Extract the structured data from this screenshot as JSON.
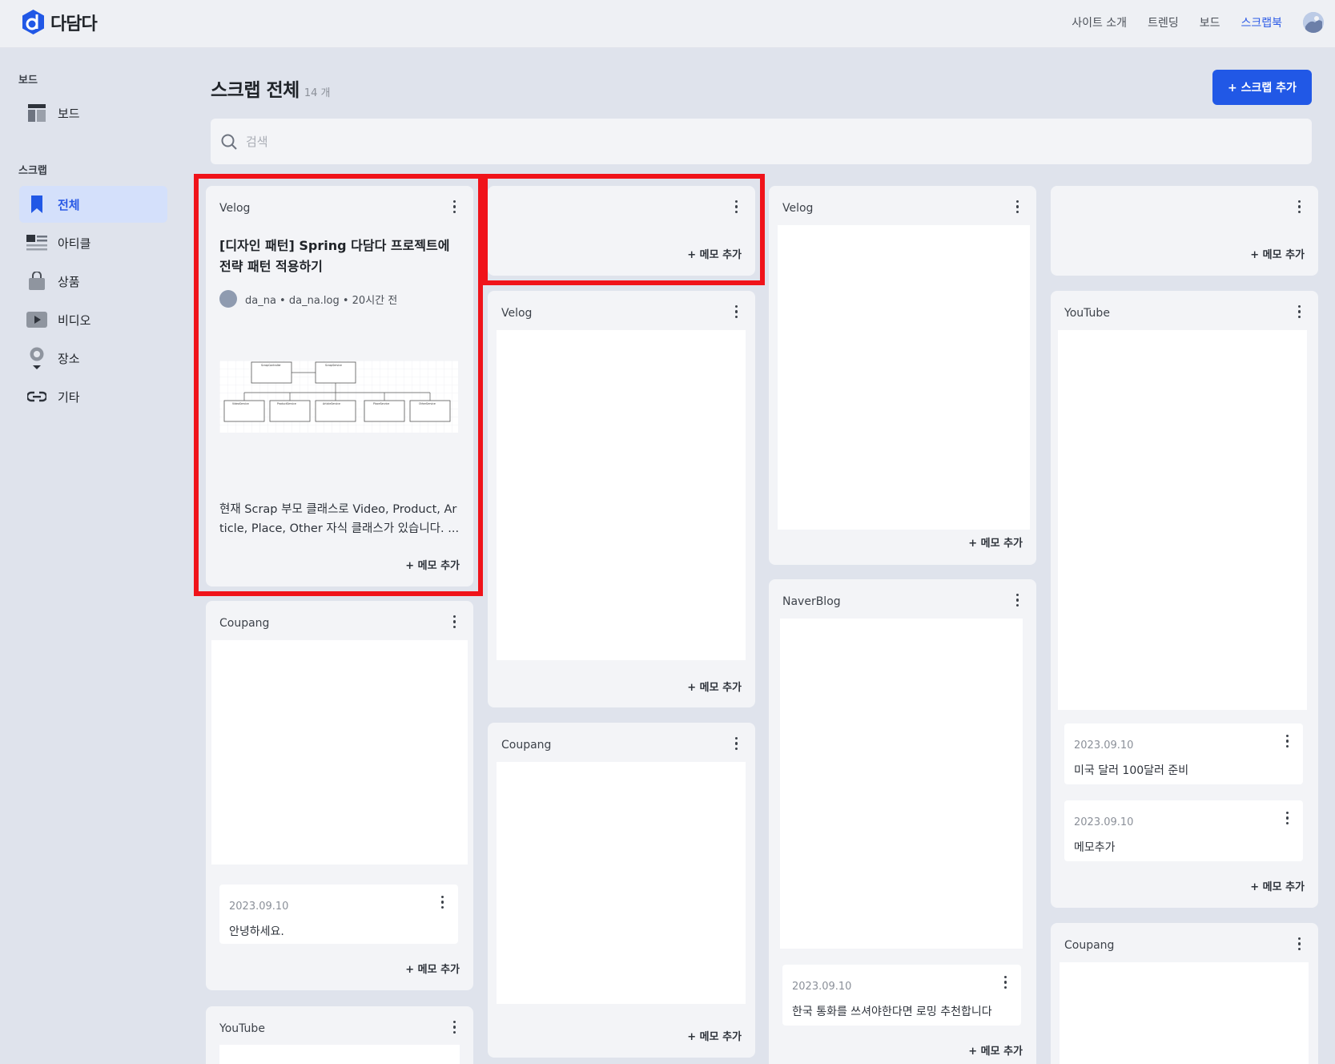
{
  "app": {
    "name": "다담다",
    "brand_color": "#2158e6"
  },
  "nav": {
    "items": [
      "사이트 소개",
      "트렌딩",
      "보드",
      "스크랩북"
    ],
    "active": "스크랩북"
  },
  "sidebar": {
    "board_section": "보드",
    "board_item": "보드",
    "scrap_section": "스크랩",
    "items": [
      {
        "label": "전체",
        "icon": "bookmark-icon",
        "active": true
      },
      {
        "label": "아티클",
        "icon": "article-icon"
      },
      {
        "label": "상품",
        "icon": "shopping-bag-icon"
      },
      {
        "label": "비디오",
        "icon": "video-icon"
      },
      {
        "label": "장소",
        "icon": "map-pin-icon"
      },
      {
        "label": "기타",
        "icon": "link-icon"
      }
    ]
  },
  "main": {
    "title": "스크랩 전체",
    "count": "14 개",
    "add_button": "+ 스크랩 추가",
    "search_placeholder": "검색"
  },
  "memo_add_label": "+ 메모 추가",
  "cards": {
    "c1": {
      "source": "Velog",
      "title": "[디자인 패턴] Spring 다담다 프로젝트에 전략 패턴 적용하기",
      "author": "da_na • da_na.log • 20시간 전",
      "description": "현재 Scrap 부모 클래스로 Video, Product, Article, Place, Other 자식 클래스가 있습니다. ..."
    },
    "c2": {
      "source": "Coupang",
      "memo_date": "2023.09.10",
      "memo_text": "안녕하세요."
    },
    "c3": {
      "source": "YouTube"
    },
    "c4": {
      "source": ""
    },
    "c5": {
      "source": "Velog"
    },
    "c6": {
      "source": "Coupang"
    },
    "c7": {
      "source": "Velog"
    },
    "c8": {
      "source": "NaverBlog",
      "memo_date": "2023.09.10",
      "memo_text": "한국 통화를 쓰셔야한다면 로밍 추천합니다"
    },
    "c9": {
      "source": ""
    },
    "c10": {
      "source": "YouTube",
      "memo1_date": "2023.09.10",
      "memo1_text": "미국 달러 100달러 준비",
      "memo2_date": "2023.09.10",
      "memo2_text": "메모추가"
    },
    "c11": {
      "source": "Coupang"
    }
  },
  "diagram_labels": {
    "top_left": "ScrapController",
    "top_right": "ScrapService",
    "bottom": [
      "VideoService",
      "ProductService",
      "ArticleService",
      "PlaceService",
      "OtherService"
    ]
  },
  "highlight_color": "#f0131a"
}
